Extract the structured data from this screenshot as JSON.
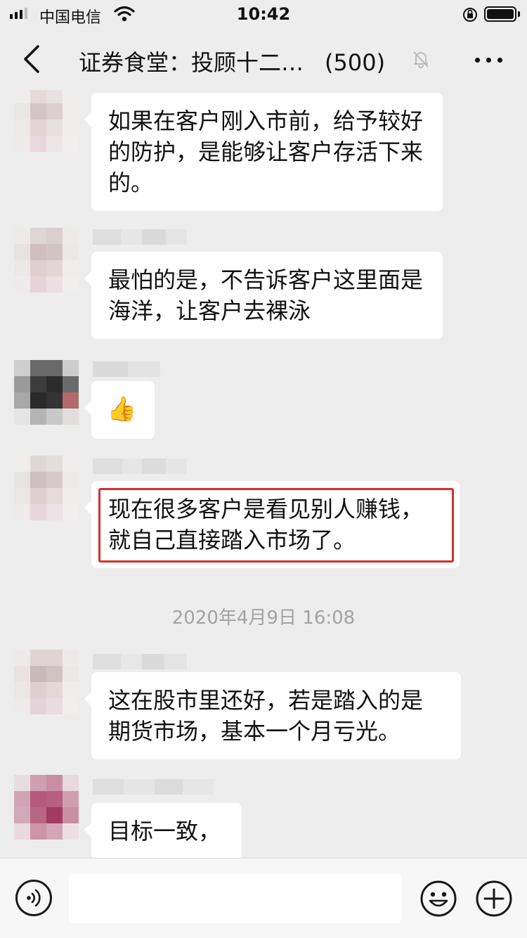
{
  "status_bar": {
    "carrier": "中国电信",
    "time": "10:42"
  },
  "nav": {
    "title": "证券食堂：投顾十二…",
    "member_count": "(500)"
  },
  "messages": [
    {
      "text": "如果在客户刚入市前，给予较好的防护，是能够让客户存活下来的。"
    },
    {
      "text": "最怕的是，不告诉客户这里面是海洋，让客户去裸泳"
    },
    {
      "emoji": "👍"
    },
    {
      "text": "现在很多客户是看见别人赚钱，就自己直接踏入市场了。"
    },
    {
      "text": "这在股市里还好，若是踏入的是期货市场，基本一个月亏光。"
    },
    {
      "text": "目标一致，"
    }
  ],
  "timestamp": "2020年4月9日 16:08",
  "colors": {
    "background": "#ededed",
    "bubble": "#ffffff",
    "highlight_border": "#d0322c",
    "timestamp_text": "#a3a3a3"
  },
  "icons": {
    "back": "chevron-left-icon",
    "mute": "bell-slash-icon",
    "more": "more-dots-icon",
    "voice": "voice-icon",
    "emoji": "smiley-icon",
    "plus": "plus-circle-icon"
  }
}
